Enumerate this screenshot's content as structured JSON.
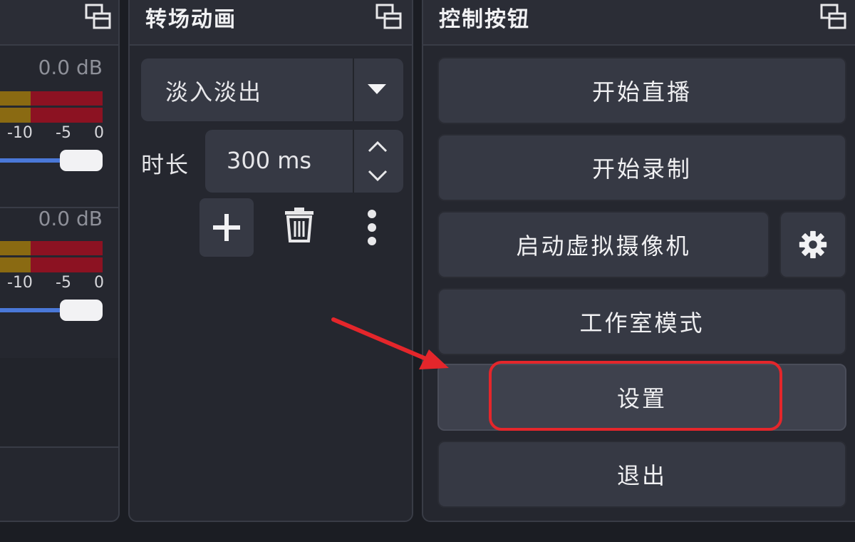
{
  "audio_mixer": {
    "channels": [
      {
        "db": "0.0 dB",
        "ticks": [
          "-10",
          "-5",
          "0"
        ],
        "volume_fraction": 1.0
      },
      {
        "db": "0.0 dB",
        "ticks": [
          "-10",
          "-5",
          "0"
        ],
        "volume_fraction": 1.0
      }
    ]
  },
  "transitions": {
    "title": "转场动画",
    "transition_value": "淡入淡出",
    "duration_label": "时长",
    "duration_value": "300 ms",
    "icons": {
      "add": "plus-icon",
      "remove": "trash-icon",
      "menu": "more-vertical-icon",
      "undock": "undock-icon"
    }
  },
  "controls": {
    "title": "控制按钮",
    "buttons": {
      "start_stream": "开始直播",
      "start_record": "开始录制",
      "virtual_camera": "启动虚拟摄像机",
      "studio_mode": "工作室模式",
      "settings": "设置",
      "exit": "退出"
    },
    "icons": {
      "virtual_camera_settings": "gear-icon"
    }
  },
  "annotation": {
    "highlight_color": "#e4262b",
    "target": "设置"
  },
  "colors": {
    "background": "#1b1d23",
    "panel": "#25272f",
    "button": "#363944",
    "meter_yellow": "#8a6a12",
    "meter_red": "#8c1222",
    "slider_blue": "#4a78d8"
  }
}
